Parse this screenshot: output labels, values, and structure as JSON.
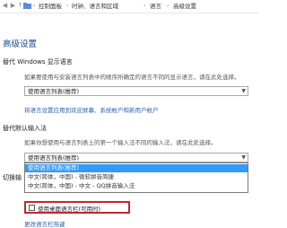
{
  "breadcrumb": {
    "back_icon": "back-arrow",
    "forward_icon": "forward-arrow",
    "up_icon": "up-arrow",
    "items": [
      "控制面板",
      "时钟、语言和区域",
      "语言",
      "高级设置"
    ]
  },
  "page": {
    "title": "高级设置"
  },
  "display_language": {
    "heading": "替代 Windows 显示语言",
    "description": "如果要使用与安装语言列表中的顺序所确定的语言不同的显示语言，请在此处选择。",
    "selected": "使用语言列表(推荐)",
    "link": "将语言设置应用到欢迎屏幕、系统帐户和新用户帐户"
  },
  "input_method": {
    "heading": "替代默认输入法",
    "description": "如果你想使用与语言列表上的第一个输入法不同的输入法，请在此处选择。",
    "selected": "使用语言列表(推荐)",
    "options": [
      "使用语言列表(推荐)",
      "中文(简体，中国) - 微软拼音简捷",
      "中文(简体，中国) - 中文 - QQ拼音输入法"
    ],
    "partial_label": "切换输"
  },
  "language_bar": {
    "checkbox_label": "使用桌面语言栏(可用时)",
    "checked": false,
    "options_link": "更改语言栏热键"
  },
  "colors": {
    "accent": "#1f4a8a",
    "link": "#2864b4",
    "selection": "#3399ff",
    "highlight_box": "#c0282d"
  }
}
